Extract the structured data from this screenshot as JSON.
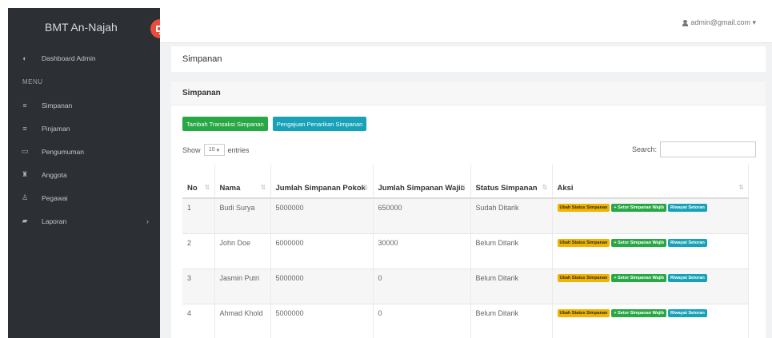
{
  "sidebar": {
    "brand": "BMT An-Najah",
    "menu_header": "MENU",
    "dashboard": {
      "label": "Dashboard Admin",
      "icon": "dashboard-icon"
    },
    "items": [
      {
        "label": "Simpanan",
        "icon": "list-icon"
      },
      {
        "label": "Pinjaman",
        "icon": "list-icon"
      },
      {
        "label": "Pengumuman",
        "icon": "card-icon"
      },
      {
        "label": "Anggota",
        "icon": "users-icon"
      },
      {
        "label": "Pegawai",
        "icon": "user-icon"
      },
      {
        "label": "Laporan",
        "icon": "book-icon"
      }
    ]
  },
  "topbar": {
    "user": "admin@gmail.com ▾"
  },
  "page": {
    "title": "Simpanan"
  },
  "card": {
    "title": "Simpanan",
    "btn_add": "Tambah Transaksi Simpanan",
    "btn_withdraw": "Pengajuan Penarikan Simpanan",
    "show_label": "Show",
    "show_value": "10",
    "entries_label": "entries",
    "search_label": "Search:"
  },
  "table": {
    "headers": [
      "No",
      "Nama",
      "Jumlah Simpanan Pokok",
      "Jumlah Simpanan Wajib",
      "Status Simpanan",
      "Aksi"
    ],
    "rows": [
      {
        "no": "1",
        "nama": "Budi Surya",
        "pokok": "5000000",
        "wajib": "650000",
        "status": "Sudah Ditarik"
      },
      {
        "no": "2",
        "nama": "John Doe",
        "pokok": "6000000",
        "wajib": "30000",
        "status": "Belum Ditarik"
      },
      {
        "no": "3",
        "nama": "Jasmin Putri",
        "pokok": "5000000",
        "wajib": "0",
        "status": "Belum Ditarik"
      },
      {
        "no": "4",
        "nama": "Ahmad Khold",
        "pokok": "5000000",
        "wajib": "0",
        "status": "Belum Ditarik"
      }
    ],
    "action_labels": {
      "ubah": "Ubah Status Simpanan",
      "setor": "+ Setor Simpanan Wajib",
      "riwayat": "Riwayat Setoran"
    }
  }
}
